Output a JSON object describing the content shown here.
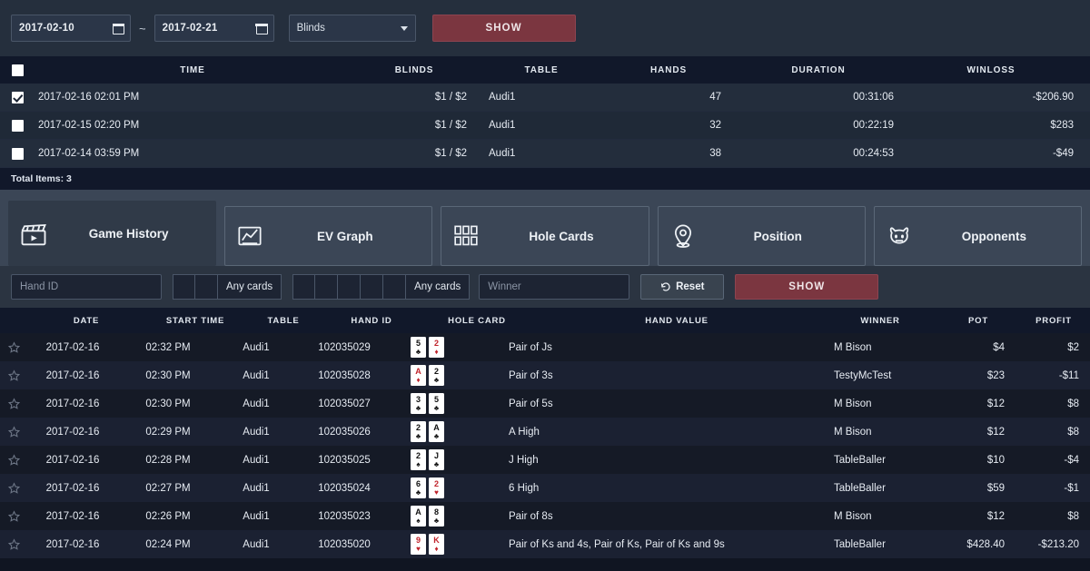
{
  "topbar": {
    "date_from": "2017-02-10",
    "date_to": "2017-02-21",
    "range_sep": "~",
    "blinds_select": "Blinds",
    "show_label": "SHOW"
  },
  "sessions": {
    "columns": [
      "TIME",
      "BLINDS",
      "TABLE",
      "HANDS",
      "DURATION",
      "WINLOSS"
    ],
    "rows": [
      {
        "checked": true,
        "time": "2017-02-16 02:01 PM",
        "blinds": "$1 / $2",
        "table": "Audi1",
        "hands": "47",
        "duration": "00:31:06",
        "winloss": "-$206.90"
      },
      {
        "checked": false,
        "time": "2017-02-15 02:20 PM",
        "blinds": "$1 / $2",
        "table": "Audi1",
        "hands": "32",
        "duration": "00:22:19",
        "winloss": "$283"
      },
      {
        "checked": false,
        "time": "2017-02-14 03:59 PM",
        "blinds": "$1 / $2",
        "table": "Audi1",
        "hands": "38",
        "duration": "00:24:53",
        "winloss": "-$49"
      }
    ],
    "total_items": "Total Items: 3"
  },
  "tabs": [
    {
      "label": "Game History",
      "icon": "clapperboard-icon",
      "active": true
    },
    {
      "label": "EV Graph",
      "icon": "line-chart-icon",
      "active": false
    },
    {
      "label": "Hole Cards",
      "icon": "grid-cards-icon",
      "active": false
    },
    {
      "label": "Position",
      "icon": "location-pin-icon",
      "active": false
    },
    {
      "label": "Opponents",
      "icon": "opponent-face-icon",
      "active": false
    }
  ],
  "handfilter": {
    "hand_id_placeholder": "Hand ID",
    "any_cards_1": "Any cards",
    "any_cards_2": "Any cards",
    "winner_placeholder": "Winner",
    "reset_label": "Reset",
    "show_label": "SHOW"
  },
  "hands": {
    "columns": [
      "DATE",
      "START TIME",
      "TABLE",
      "HAND ID",
      "HOLE CARD",
      "HAND VALUE",
      "WINNER",
      "POT",
      "PROFIT"
    ],
    "rows": [
      {
        "date": "2017-02-16",
        "start": "02:32 PM",
        "table": "Audi1",
        "id": "102035029",
        "cards": [
          {
            "rank": "5",
            "suit": "♣",
            "color": "black"
          },
          {
            "rank": "2",
            "suit": "♦",
            "color": "red"
          }
        ],
        "value": "Pair of Js",
        "winner": "M Bison",
        "pot": "$4",
        "profit": "$2"
      },
      {
        "date": "2017-02-16",
        "start": "02:30 PM",
        "table": "Audi1",
        "id": "102035028",
        "cards": [
          {
            "rank": "A",
            "suit": "♦",
            "color": "red"
          },
          {
            "rank": "2",
            "suit": "♣",
            "color": "black"
          }
        ],
        "value": "Pair of 3s",
        "winner": "TestyMcTest",
        "pot": "$23",
        "profit": "-$11"
      },
      {
        "date": "2017-02-16",
        "start": "02:30 PM",
        "table": "Audi1",
        "id": "102035027",
        "cards": [
          {
            "rank": "3",
            "suit": "♣",
            "color": "black"
          },
          {
            "rank": "5",
            "suit": "♣",
            "color": "black"
          }
        ],
        "value": "Pair of 5s",
        "winner": "M Bison",
        "pot": "$12",
        "profit": "$8"
      },
      {
        "date": "2017-02-16",
        "start": "02:29 PM",
        "table": "Audi1",
        "id": "102035026",
        "cards": [
          {
            "rank": "2",
            "suit": "♣",
            "color": "black"
          },
          {
            "rank": "A",
            "suit": "♣",
            "color": "black"
          }
        ],
        "value": "A High",
        "winner": "M Bison",
        "pot": "$12",
        "profit": "$8"
      },
      {
        "date": "2017-02-16",
        "start": "02:28 PM",
        "table": "Audi1",
        "id": "102035025",
        "cards": [
          {
            "rank": "2",
            "suit": "♠",
            "color": "black"
          },
          {
            "rank": "J",
            "suit": "♣",
            "color": "black"
          }
        ],
        "value": "J High",
        "winner": "TableBaller",
        "pot": "$10",
        "profit": "-$4"
      },
      {
        "date": "2017-02-16",
        "start": "02:27 PM",
        "table": "Audi1",
        "id": "102035024",
        "cards": [
          {
            "rank": "6",
            "suit": "♣",
            "color": "black"
          },
          {
            "rank": "2",
            "suit": "♥",
            "color": "red"
          }
        ],
        "value": "6 High",
        "winner": "TableBaller",
        "pot": "$59",
        "profit": "-$1"
      },
      {
        "date": "2017-02-16",
        "start": "02:26 PM",
        "table": "Audi1",
        "id": "102035023",
        "cards": [
          {
            "rank": "A",
            "suit": "♠",
            "color": "black"
          },
          {
            "rank": "8",
            "suit": "♣",
            "color": "black"
          }
        ],
        "value": "Pair of 8s",
        "winner": "M Bison",
        "pot": "$12",
        "profit": "$8"
      },
      {
        "date": "2017-02-16",
        "start": "02:24 PM",
        "table": "Audi1",
        "id": "102035020",
        "cards": [
          {
            "rank": "9",
            "suit": "♥",
            "color": "red"
          },
          {
            "rank": "K",
            "suit": "♦",
            "color": "red"
          }
        ],
        "value": "Pair of Ks and 4s, Pair of Ks, Pair of Ks and 9s",
        "winner": "TableBaller",
        "pot": "$428.40",
        "profit": "-$213.20"
      }
    ]
  },
  "colors": {
    "accent_show": "#7b3640",
    "topbar_bg": "#252f3d",
    "tabstrip_bg": "#3b4656",
    "table_header_bg": "#11182a"
  }
}
